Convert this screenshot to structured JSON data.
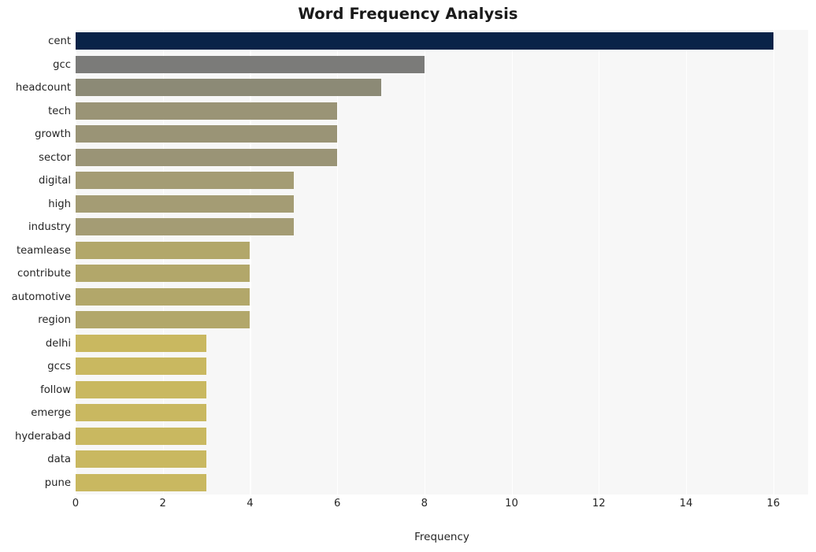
{
  "chart_data": {
    "type": "bar",
    "orientation": "horizontal",
    "title": "Word Frequency Analysis",
    "xlabel": "Frequency",
    "ylabel": "",
    "categories": [
      "cent",
      "gcc",
      "headcount",
      "tech",
      "growth",
      "sector",
      "digital",
      "high",
      "industry",
      "teamlease",
      "contribute",
      "automotive",
      "region",
      "delhi",
      "gccs",
      "follow",
      "emerge",
      "hyderabad",
      "data",
      "pune"
    ],
    "values": [
      16,
      8,
      7,
      6,
      6,
      6,
      5,
      5,
      5,
      4,
      4,
      4,
      4,
      3,
      3,
      3,
      3,
      3,
      3,
      3
    ],
    "xlim": [
      0,
      16.8
    ],
    "xticks": [
      0,
      2,
      4,
      6,
      8,
      10,
      12,
      14,
      16
    ],
    "xticklabels": [
      "0",
      "2",
      "4",
      "6",
      "8",
      "10",
      "12",
      "14",
      "16"
    ],
    "grid": true,
    "grid_axis": "x",
    "grid_color": "#ffffff",
    "legend": false,
    "plot_background": "#f7f7f7",
    "figure_background": "#ffffff",
    "bar_colors": [
      "#092348",
      "#7b7b79",
      "#8c8a76",
      "#9a9476",
      "#9a9476",
      "#9a9476",
      "#a49c74",
      "#a49c74",
      "#a49c74",
      "#b2a76a",
      "#b2a76a",
      "#b2a76a",
      "#b2a76a",
      "#c9b860",
      "#c9b860",
      "#c9b860",
      "#c9b860",
      "#c9b860",
      "#c9b860",
      "#c9b860"
    ]
  },
  "axis": {
    "tick_color": "#262626",
    "title_color": "#1a1a1a"
  }
}
